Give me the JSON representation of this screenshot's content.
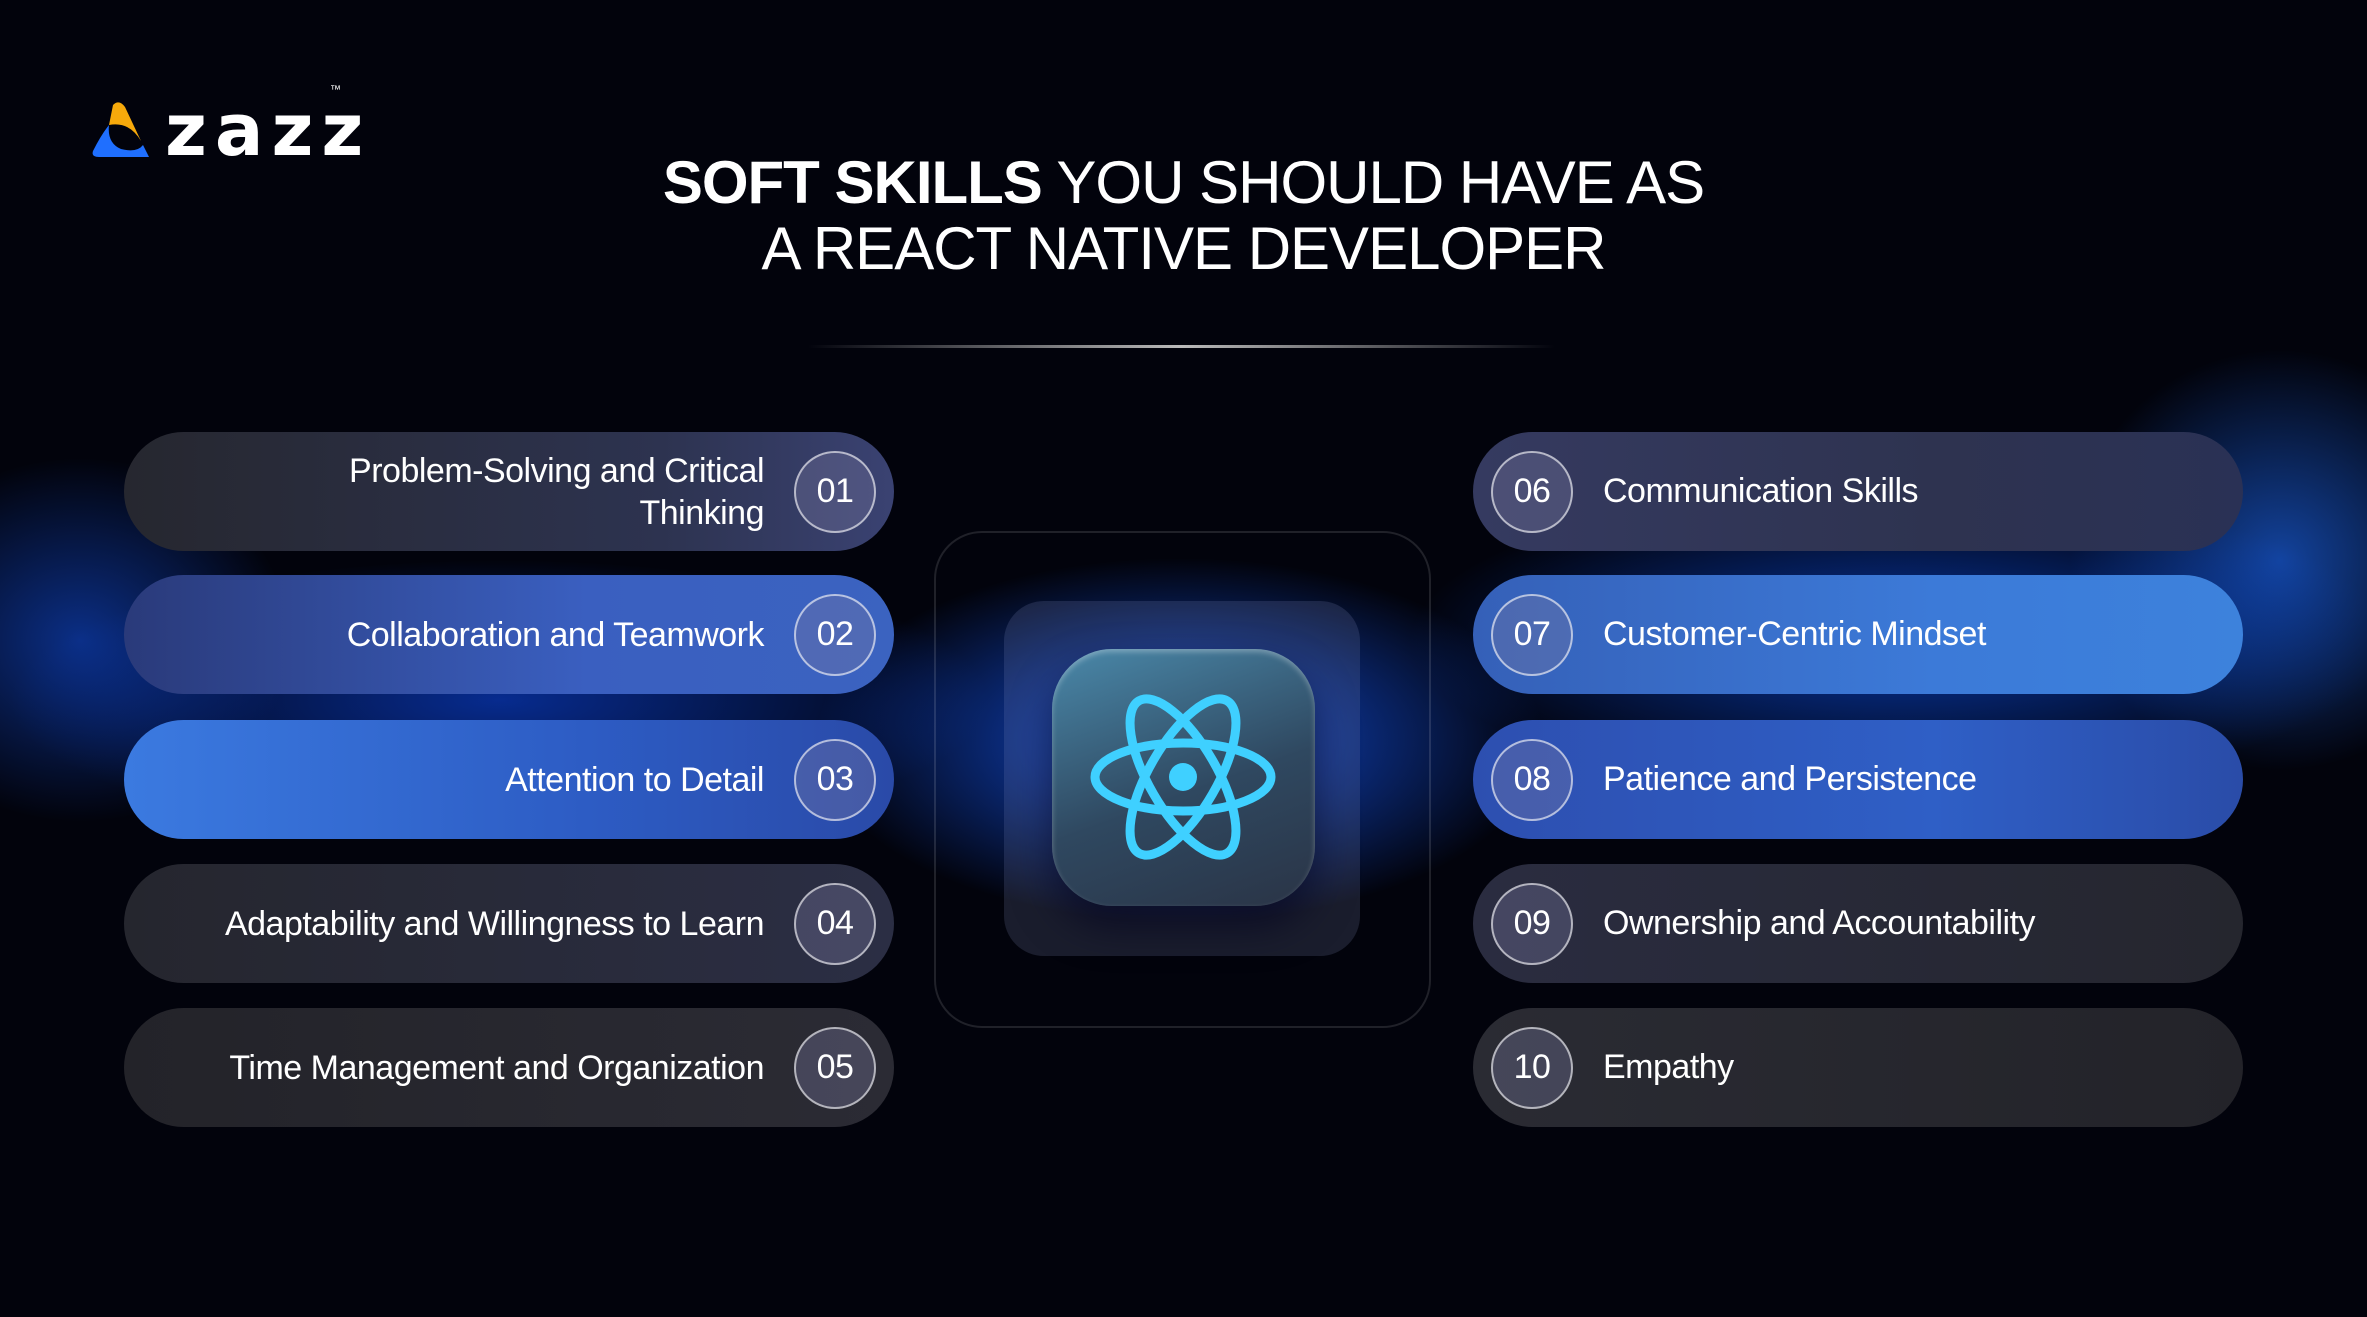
{
  "brand": {
    "name": "zazz",
    "trademark": "™",
    "colors": {
      "yellow": "#f6a90b",
      "blue": "#1f6fff"
    }
  },
  "title": {
    "bold": "SOFT SKILLS",
    "rest_line1": " YOU SHOULD HAVE AS",
    "line2": "A REACT NATIVE DEVELOPER"
  },
  "center_icon": "react-atom-icon",
  "left_items": [
    {
      "num": "01",
      "label": "Problem-Solving and Critical Thinking"
    },
    {
      "num": "02",
      "label": "Collaboration and Teamwork"
    },
    {
      "num": "03",
      "label": "Attention to Detail"
    },
    {
      "num": "04",
      "label": "Adaptability and Willingness to Learn"
    },
    {
      "num": "05",
      "label": "Time Management and Organization"
    }
  ],
  "right_items": [
    {
      "num": "06",
      "label": "Communication Skills"
    },
    {
      "num": "07",
      "label": "Customer-Centric Mindset"
    },
    {
      "num": "08",
      "label": "Patience and Persistence"
    },
    {
      "num": "09",
      "label": "Ownership and Accountability"
    },
    {
      "num": "10",
      "label": "Empathy"
    }
  ]
}
